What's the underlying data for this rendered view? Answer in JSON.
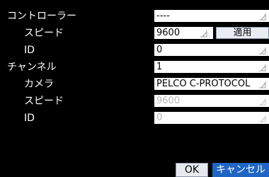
{
  "settings": {
    "controller": {
      "label": "コントローラー",
      "value": "----"
    },
    "controller_speed": {
      "label": "スピード",
      "value": "9600"
    },
    "controller_id": {
      "label": "ID",
      "value": "0"
    },
    "channel": {
      "label": "チャンネル",
      "value": "1"
    },
    "camera": {
      "label": "カメラ",
      "value": "PELCO C-PROTOCOL"
    },
    "camera_speed": {
      "label": "スピード",
      "value": "9600"
    },
    "camera_id": {
      "label": "ID",
      "value": "0"
    }
  },
  "buttons": {
    "apply": "適用",
    "ok": "OK",
    "cancel": "キャンセル"
  },
  "colors": {
    "background": "#000000",
    "field": "#ffffff",
    "disabled_text": "#b6b6b6",
    "cancel_highlight": "#1f66c4"
  },
  "icons": {
    "dropdown": "dropdown-corner-icon"
  }
}
